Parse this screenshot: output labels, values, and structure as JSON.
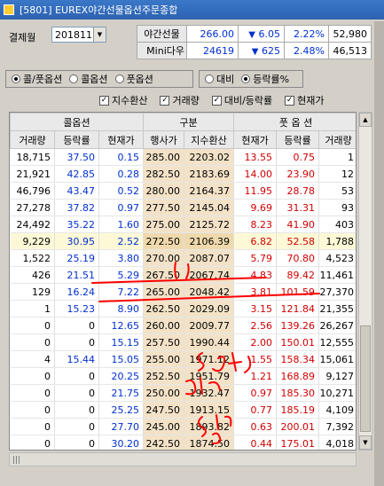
{
  "window": {
    "title": "[5801] EUREX야간선물옵션주문종합"
  },
  "settlement": {
    "label": "결제월",
    "value": "201811"
  },
  "quotes": [
    {
      "name": "야간선물",
      "price": "266.00",
      "arrow": "▼",
      "change": "6.05",
      "rate": "2.22%",
      "volume": "52,980"
    },
    {
      "name": "Mini다우",
      "price": "24619",
      "arrow": "▼",
      "change": "625",
      "rate": "2.48%",
      "volume": "46,513"
    }
  ],
  "option_type": {
    "options": [
      "콜/풋옵션",
      "콜옵션",
      "풋옵션"
    ],
    "selected": "콜/풋옵션"
  },
  "display_mode": {
    "options": [
      "대비",
      "등락률%"
    ],
    "selected": "등락률%"
  },
  "checks": [
    {
      "label": "지수환산",
      "checked": true
    },
    {
      "label": "거래량",
      "checked": true
    },
    {
      "label": "대비/등락률",
      "checked": true
    },
    {
      "label": "현재가",
      "checked": true
    }
  ],
  "grid": {
    "groups": [
      "콜옵션",
      "구분",
      "풋 옵 션"
    ],
    "headers": [
      "거래량",
      "등락률",
      "현재가",
      "행사가",
      "지수환산",
      "현재가",
      "등락률",
      "거래량"
    ],
    "rows": [
      [
        "18,715",
        "37.50",
        "0.15",
        "285.00",
        "2203.02",
        "13.55",
        "0.75",
        "1"
      ],
      [
        "21,921",
        "42.85",
        "0.28",
        "282.50",
        "2183.69",
        "14.00",
        "23.90",
        "12"
      ],
      [
        "46,796",
        "43.47",
        "0.52",
        "280.00",
        "2164.37",
        "11.95",
        "28.78",
        "53"
      ],
      [
        "27,278",
        "37.82",
        "0.97",
        "277.50",
        "2145.04",
        "9.69",
        "31.31",
        "93"
      ],
      [
        "24,492",
        "35.22",
        "1.60",
        "275.00",
        "2125.72",
        "8.23",
        "41.90",
        "403"
      ],
      [
        "9,229",
        "30.95",
        "2.52",
        "272.50",
        "2106.39",
        "6.82",
        "52.58",
        "1,788"
      ],
      [
        "1,522",
        "25.19",
        "3.80",
        "270.00",
        "2087.07",
        "5.79",
        "70.80",
        "4,523"
      ],
      [
        "426",
        "21.51",
        "5.29",
        "267.50",
        "2067.74",
        "4.83",
        "89.42",
        "11,461"
      ],
      [
        "129",
        "16.24",
        "7.22",
        "265.00",
        "2048.42",
        "3.81",
        "101.59",
        "27,370"
      ],
      [
        "1",
        "15.23",
        "8.90",
        "262.50",
        "2029.09",
        "3.15",
        "121.84",
        "21,355"
      ],
      [
        "0",
        "0",
        "12.65",
        "260.00",
        "2009.77",
        "2.56",
        "139.26",
        "26,267"
      ],
      [
        "0",
        "0",
        "15.15",
        "257.50",
        "1990.44",
        "2.00",
        "150.01",
        "12,555"
      ],
      [
        "4",
        "15.44",
        "15.05",
        "255.00",
        "1971.12",
        "1.55",
        "158.34",
        "15,061"
      ],
      [
        "0",
        "0",
        "20.25",
        "252.50",
        "1951.79",
        "1.21",
        "168.89",
        "9,127"
      ],
      [
        "0",
        "0",
        "21.75",
        "250.00",
        "1932.47",
        "0.97",
        "185.30",
        "10,271"
      ],
      [
        "0",
        "0",
        "25.25",
        "247.50",
        "1913.15",
        "0.77",
        "185.19",
        "4,109"
      ],
      [
        "0",
        "0",
        "27.70",
        "245.00",
        "1893.82",
        "0.63",
        "200.01",
        "7,392"
      ],
      [
        "0",
        "0",
        "30.20",
        "242.50",
        "1874.50",
        "0.44",
        "175.01",
        "4,018"
      ]
    ],
    "atm_row": 5
  },
  "colors": {
    "call_rate": "#0030d0",
    "put_value": "#d00000",
    "annotation": "#ff0000"
  }
}
